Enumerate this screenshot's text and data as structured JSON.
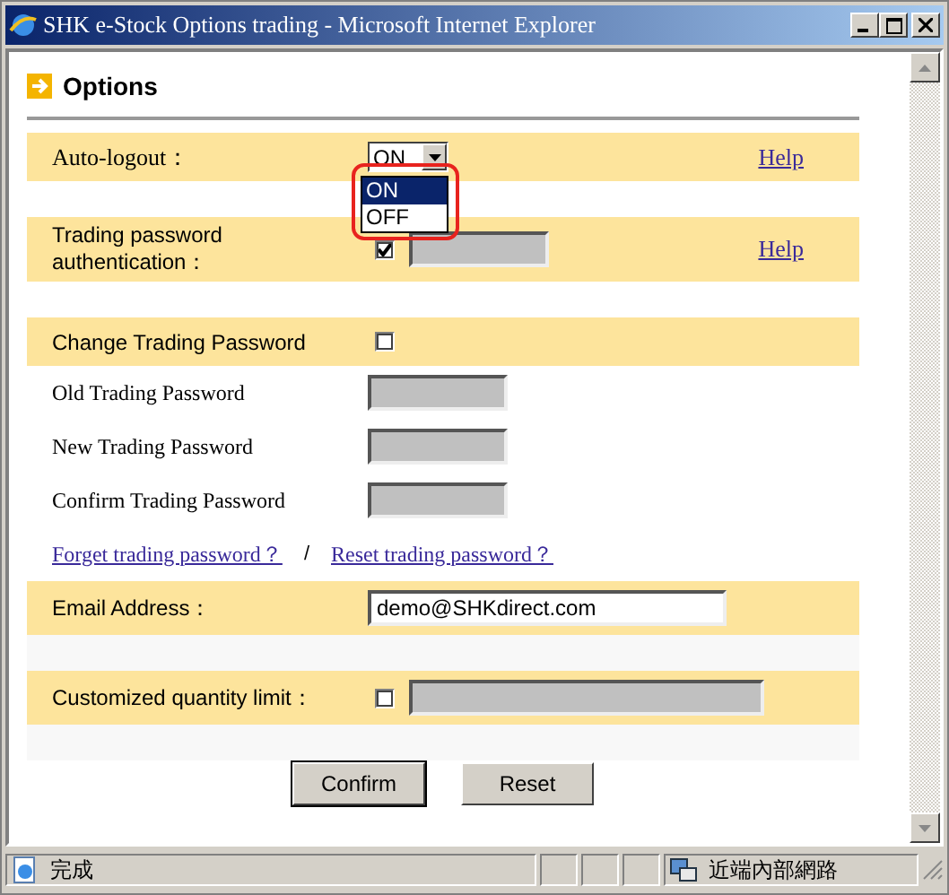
{
  "window": {
    "title": "SHK e-Stock Options trading - Microsoft Internet Explorer"
  },
  "heading": "Options",
  "rows": [
    {
      "kind": "select",
      "label": "Auto-logout：",
      "value": "ON",
      "help": "Help",
      "options": [
        {
          "label": "ON",
          "selected": true
        },
        {
          "label": "OFF",
          "selected": false
        }
      ]
    },
    {
      "kind": "gap"
    },
    {
      "kind": "auth_check",
      "label": "Trading password authentication：",
      "checked": true,
      "help": "Help"
    },
    {
      "kind": "gap"
    },
    {
      "kind": "section_check",
      "label": "Change Trading Password",
      "checked": false
    },
    {
      "kind": "password",
      "label": "Old Trading Password"
    },
    {
      "kind": "password",
      "label": "New Trading Password"
    },
    {
      "kind": "password",
      "label": "Confirm Trading Password"
    },
    {
      "kind": "links",
      "links": [
        "Forget trading password？",
        "Reset trading password？"
      ],
      "separator": "/"
    },
    {
      "kind": "text_input",
      "label": "Email Address：",
      "value": "demo@SHKdirect.com"
    },
    {
      "kind": "shaded_gap"
    },
    {
      "kind": "limit_check",
      "label": "Customized quantity limit：",
      "checked": false
    },
    {
      "kind": "shaded_gap"
    }
  ],
  "buttons": [
    {
      "label": "Confirm",
      "default": true
    },
    {
      "label": "Reset",
      "default": false
    }
  ],
  "status_bar": {
    "text": "完成",
    "zone": "近端內部網路"
  }
}
